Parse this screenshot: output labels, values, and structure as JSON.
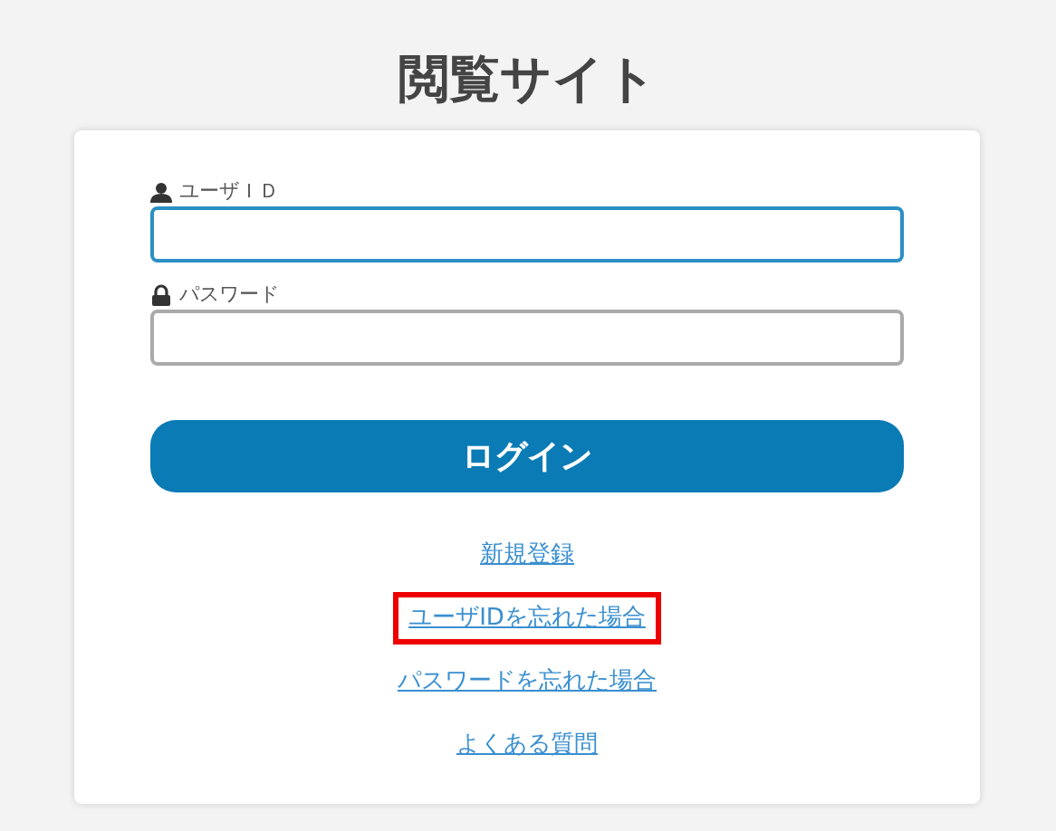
{
  "title": "閲覧サイト",
  "fields": [
    {
      "kind": "user",
      "label": "ユーザＩＤ",
      "focused": true
    },
    {
      "kind": "lock",
      "label": "パスワード",
      "focused": false
    }
  ],
  "login_button": "ログイン",
  "links": [
    {
      "text": "新規登録",
      "highlighted": false
    },
    {
      "text": "ユーザIDを忘れた場合",
      "highlighted": true
    },
    {
      "text": "パスワードを忘れた場合",
      "highlighted": false
    },
    {
      "text": "よくある質問",
      "highlighted": false
    }
  ]
}
